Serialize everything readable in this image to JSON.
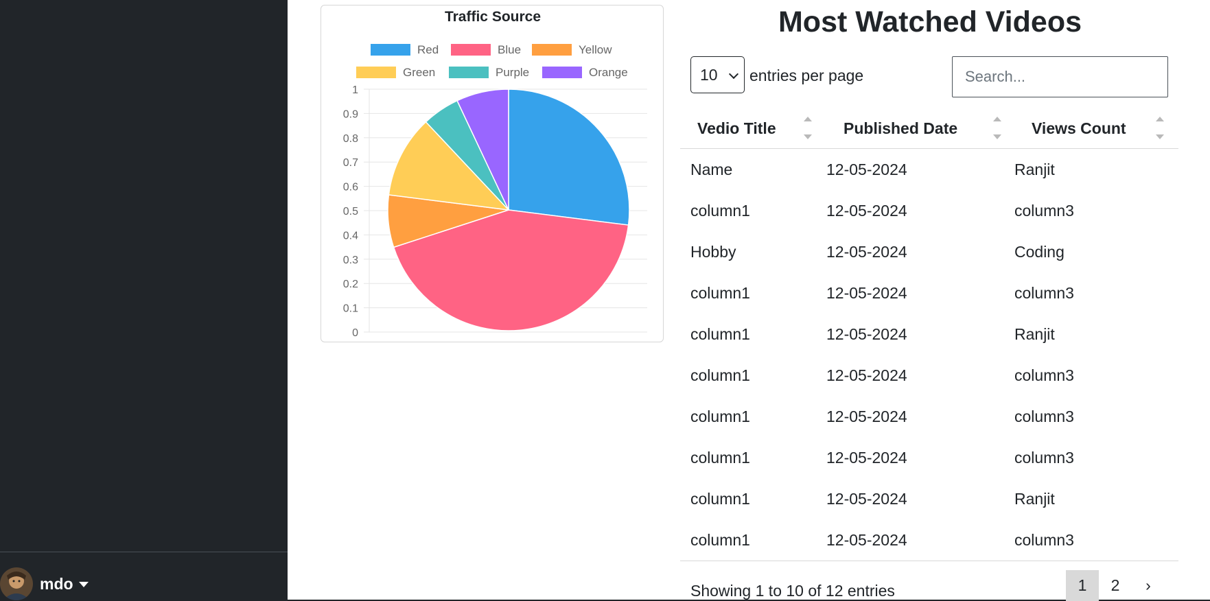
{
  "sidebar": {
    "user": {
      "name": "mdo",
      "avatar_icon": "user-avatar-photo"
    }
  },
  "chart_data": {
    "type": "pie",
    "title": "Traffic Source",
    "legend_position": "top",
    "labels": [
      "Red",
      "Blue",
      "Yellow",
      "Green",
      "Purple",
      "Orange"
    ],
    "values": [
      27,
      43,
      7,
      11,
      5,
      7
    ],
    "colors": [
      "#36a2eb",
      "#ff6384",
      "#ff9f40",
      "#ffcd56",
      "#4bc0c0",
      "#9966ff"
    ],
    "y_ticks": [
      "1",
      "0.9",
      "0.8",
      "0.7",
      "0.6",
      "0.5",
      "0.4",
      "0.3",
      "0.2",
      "0.1",
      "0"
    ],
    "ylim": [
      0,
      1
    ],
    "grid": true
  },
  "videos": {
    "title": "Most Watched Videos",
    "page_size": "10",
    "entries_label": "entries per page",
    "search_placeholder": "Search...",
    "columns": [
      "Vedio Title",
      "Published Date",
      "Views Count"
    ],
    "rows": [
      [
        "Name",
        "12-05-2024",
        "Ranjit"
      ],
      [
        "column1",
        "12-05-2024",
        "column3"
      ],
      [
        "Hobby",
        "12-05-2024",
        "Coding"
      ],
      [
        "column1",
        "12-05-2024",
        "column3"
      ],
      [
        "column1",
        "12-05-2024",
        "Ranjit"
      ],
      [
        "column1",
        "12-05-2024",
        "column3"
      ],
      [
        "column1",
        "12-05-2024",
        "column3"
      ],
      [
        "column1",
        "12-05-2024",
        "column3"
      ],
      [
        "column1",
        "12-05-2024",
        "Ranjit"
      ],
      [
        "column1",
        "12-05-2024",
        "column3"
      ]
    ],
    "showing": "Showing 1 to 10 of 12 entries",
    "pages": [
      "1",
      "2"
    ],
    "next_label": "›",
    "active_page": "1"
  }
}
